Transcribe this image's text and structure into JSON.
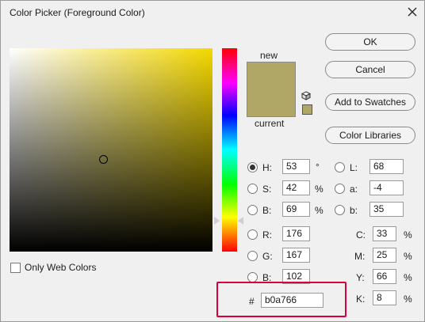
{
  "window": {
    "title": "Color Picker (Foreground Color)"
  },
  "preview": {
    "new_label": "new",
    "current_label": "current",
    "new_color": "#b0a766",
    "current_color": "#b0a766"
  },
  "field": {
    "hue_base_color": "#f5d800"
  },
  "buttons": {
    "ok": "OK",
    "cancel": "Cancel",
    "add_to_swatches": "Add to Swatches",
    "color_libraries": "Color Libraries"
  },
  "hsb": {
    "h": {
      "label": "H:",
      "value": "53",
      "unit": "°",
      "selected": true
    },
    "s": {
      "label": "S:",
      "value": "42",
      "unit": "%"
    },
    "b": {
      "label": "B:",
      "value": "69",
      "unit": "%"
    }
  },
  "lab": {
    "l": {
      "label": "L:",
      "value": "68"
    },
    "a": {
      "label": "a:",
      "value": "-4"
    },
    "b": {
      "label": "b:",
      "value": "35"
    }
  },
  "rgb": {
    "r": {
      "label": "R:",
      "value": "176"
    },
    "g": {
      "label": "G:",
      "value": "167"
    },
    "b": {
      "label": "B:",
      "value": "102"
    }
  },
  "cmyk": {
    "c": {
      "label": "C:",
      "value": "33",
      "unit": "%"
    },
    "m": {
      "label": "M:",
      "value": "25",
      "unit": "%"
    },
    "y": {
      "label": "Y:",
      "value": "66",
      "unit": "%"
    },
    "k": {
      "label": "K:",
      "value": "8",
      "unit": "%"
    }
  },
  "hex": {
    "label": "#",
    "value": "b0a766"
  },
  "options": {
    "only_web_colors": "Only Web Colors"
  },
  "colors": {
    "highlight_border": "#d9003a"
  }
}
